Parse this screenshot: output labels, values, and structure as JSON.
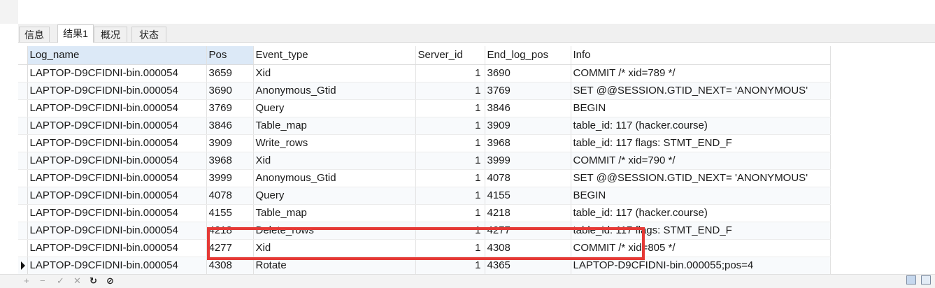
{
  "tabs": [
    "信息",
    "结果1",
    "概况",
    "状态"
  ],
  "grid": {
    "columns": [
      "Log_name",
      "Pos",
      "Event_type",
      "Server_id",
      "End_log_pos",
      "Info"
    ],
    "rows": [
      [
        "LAPTOP-D9CFIDNI-bin.000054",
        "3659",
        "Xid",
        "1",
        "3690",
        "COMMIT /* xid=789 */"
      ],
      [
        "LAPTOP-D9CFIDNI-bin.000054",
        "3690",
        "Anonymous_Gtid",
        "1",
        "3769",
        "SET @@SESSION.GTID_NEXT= 'ANONYMOUS'"
      ],
      [
        "LAPTOP-D9CFIDNI-bin.000054",
        "3769",
        "Query",
        "1",
        "3846",
        "BEGIN"
      ],
      [
        "LAPTOP-D9CFIDNI-bin.000054",
        "3846",
        "Table_map",
        "1",
        "3909",
        "table_id: 117 (hacker.course)"
      ],
      [
        "LAPTOP-D9CFIDNI-bin.000054",
        "3909",
        "Write_rows",
        "1",
        "3968",
        "table_id: 117 flags: STMT_END_F"
      ],
      [
        "LAPTOP-D9CFIDNI-bin.000054",
        "3968",
        "Xid",
        "1",
        "3999",
        "COMMIT /* xid=790 */"
      ],
      [
        "LAPTOP-D9CFIDNI-bin.000054",
        "3999",
        "Anonymous_Gtid",
        "1",
        "4078",
        "SET @@SESSION.GTID_NEXT= 'ANONYMOUS'"
      ],
      [
        "LAPTOP-D9CFIDNI-bin.000054",
        "4078",
        "Query",
        "1",
        "4155",
        "BEGIN"
      ],
      [
        "LAPTOP-D9CFIDNI-bin.000054",
        "4155",
        "Table_map",
        "1",
        "4218",
        "table_id: 117 (hacker.course)"
      ],
      [
        "LAPTOP-D9CFIDNI-bin.000054",
        "4218",
        "Delete_rows",
        "1",
        "4277",
        "table_id: 117 flags: STMT_END_F"
      ],
      [
        "LAPTOP-D9CFIDNI-bin.000054",
        "4277",
        "Xid",
        "1",
        "4308",
        "COMMIT /* xid=805 */"
      ],
      [
        "LAPTOP-D9CFIDNI-bin.000054",
        "4308",
        "Rotate",
        "1",
        "4365",
        "LAPTOP-D9CFIDNI-bin.000055;pos=4"
      ]
    ]
  },
  "toolbar": [
    {
      "glyph": "+",
      "icon": "add-row-icon"
    },
    {
      "glyph": "−",
      "icon": "delete-row-icon"
    },
    {
      "glyph": "✓",
      "icon": "apply-icon"
    },
    {
      "glyph": "✕",
      "icon": "discard-icon"
    },
    {
      "glyph": "↻",
      "icon": "refresh-icon"
    },
    {
      "glyph": "⊘",
      "icon": "stop-icon"
    }
  ],
  "colors": {
    "highlight": "#e53935",
    "selected_column": "#dce9f7"
  }
}
